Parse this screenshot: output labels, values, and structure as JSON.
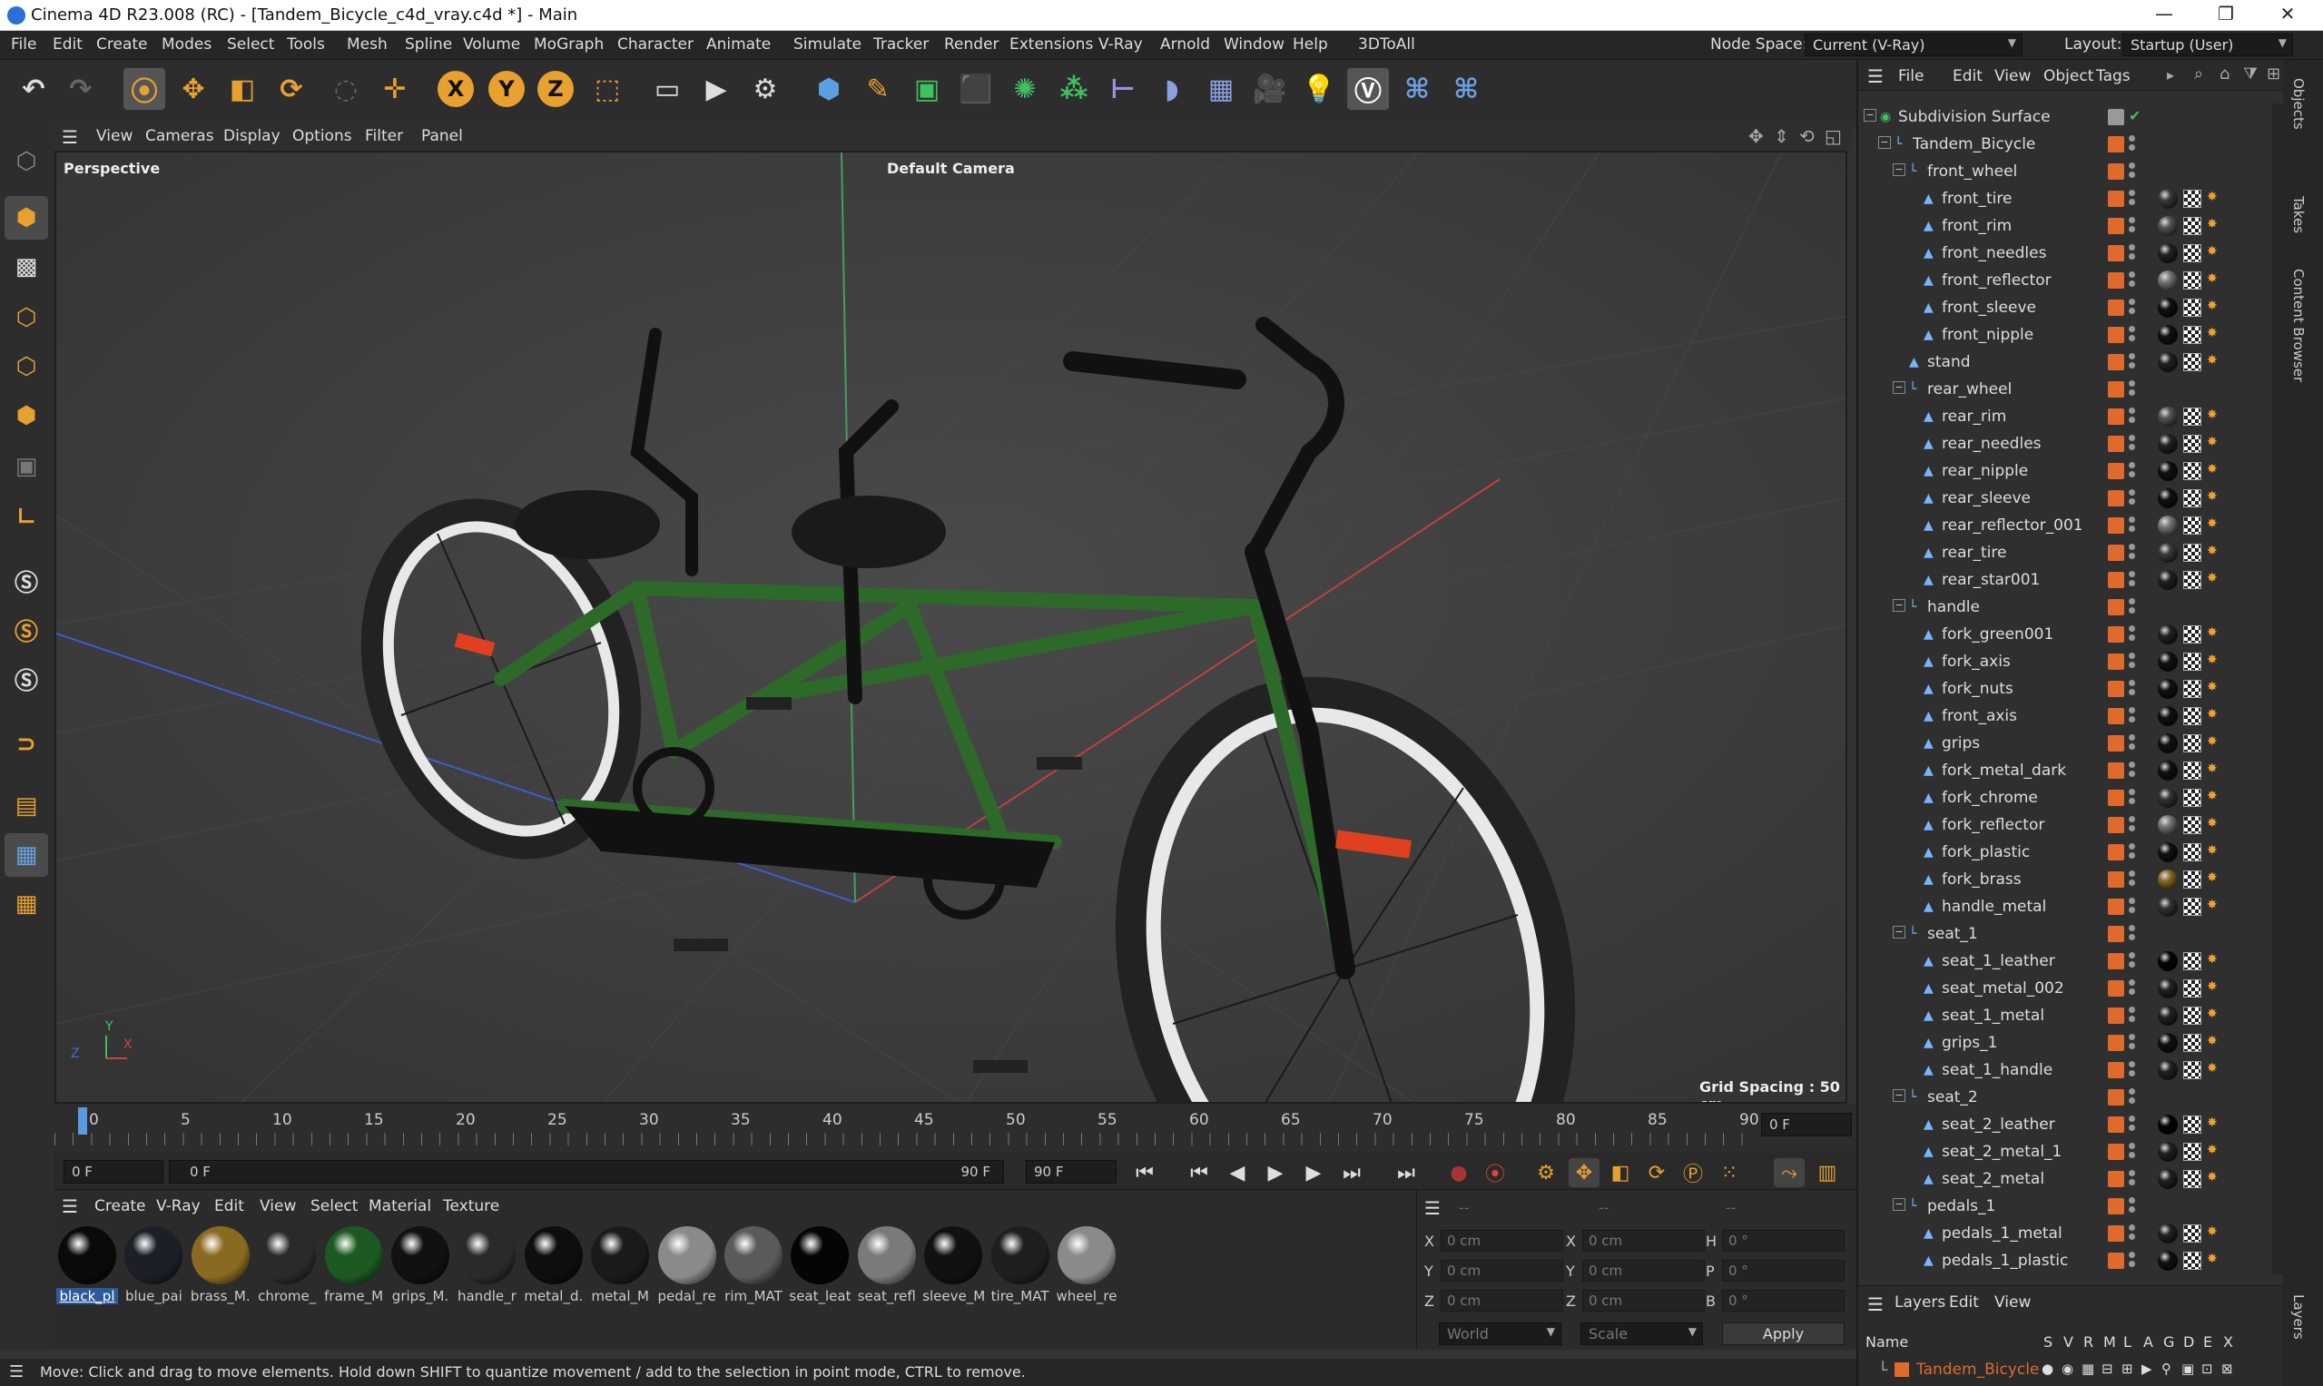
{
  "window": {
    "title": "Cinema 4D R23.008 (RC) - [Tandem_Bicycle_c4d_vray.c4d *] - Main",
    "minimize": "—",
    "maximize": "❐",
    "close": "✕"
  },
  "menubar": {
    "items": [
      "File",
      "Edit",
      "Create",
      "Modes",
      "Select",
      "Tools",
      "Mesh",
      "Spline",
      "Volume",
      "MoGraph",
      "Character",
      "Animate",
      "Simulate",
      "Tracker",
      "Render",
      "Extensions",
      "V-Ray",
      "Arnold",
      "Window",
      "Help",
      "3DToAll"
    ],
    "node_space_label": "Node Space:",
    "node_space_value": "Current (V-Ray)",
    "layout_label": "Layout:",
    "layout_value": "Startup (User)"
  },
  "toolbar": {
    "x_axis": "X",
    "y_axis": "Y",
    "z_axis": "Z"
  },
  "viewport": {
    "menu": [
      "View",
      "Cameras",
      "Display",
      "Options",
      "Filter",
      "Panel"
    ],
    "projection": "Perspective",
    "camera": "Default Camera",
    "grid_spacing": "Grid Spacing : 50 cm",
    "axis_x": "X",
    "axis_y": "Y",
    "axis_z": "Z"
  },
  "timeline": {
    "ticks": [
      "0",
      "5",
      "10",
      "15",
      "20",
      "25",
      "30",
      "35",
      "40",
      "45",
      "50",
      "55",
      "60",
      "65",
      "70",
      "75",
      "80",
      "85",
      "90"
    ],
    "current_frame": "0 F",
    "start_field": "0 F",
    "range_start": "0 F",
    "range_end": "90 F",
    "end_field": "90 F"
  },
  "materials": {
    "menu": [
      "Create",
      "V-Ray",
      "Edit",
      "View",
      "Select",
      "Material",
      "Texture"
    ],
    "items": [
      {
        "label": "black_pl",
        "color": "#0a0a0a",
        "selected": true
      },
      {
        "label": "blue_pai",
        "color": "#1c1f28"
      },
      {
        "label": "brass_M.",
        "color": "#8a6a20"
      },
      {
        "label": "chrome_",
        "color": "#2a2a2a"
      },
      {
        "label": "frame_M",
        "color": "#1d5a22"
      },
      {
        "label": "grips_M.",
        "color": "#111111"
      },
      {
        "label": "handle_r",
        "color": "#2a2a2a"
      },
      {
        "label": "metal_d.",
        "color": "#0e0e0e"
      },
      {
        "label": "metal_M",
        "color": "#1a1a1a"
      },
      {
        "label": "pedal_re",
        "color": "#8a8a8a"
      },
      {
        "label": "rim_MAT",
        "color": "#5a5a5a"
      },
      {
        "label": "seat_leat",
        "color": "#050505"
      },
      {
        "label": "seat_refl",
        "color": "#7a7a7a"
      },
      {
        "label": "sleeve_M",
        "color": "#111111"
      },
      {
        "label": "tire_MAT",
        "color": "#1e1e1e"
      },
      {
        "label": "wheel_re",
        "color": "#8a8a8a"
      }
    ]
  },
  "coords": {
    "x_label": "X",
    "y_label": "Y",
    "z_label": "Z",
    "h_label": "H",
    "p_label": "P",
    "b_label": "B",
    "pos_x": "0 cm",
    "pos_y": "0 cm",
    "pos_z": "0 cm",
    "size_x": "0 cm",
    "size_y": "0 cm",
    "size_z": "0 cm",
    "rot_h": "0 °",
    "rot_p": "0 °",
    "rot_b": "0 °",
    "header_1": "--",
    "header_2": "--",
    "header_3": "--",
    "mode_1": "World",
    "mode_2": "Scale",
    "apply": "Apply"
  },
  "status": "Move: Click and drag to move elements. Hold down SHIFT to quantize movement / add to the selection in point mode, CTRL to remove.",
  "objects": {
    "menu": [
      "File",
      "Edit",
      "View",
      "Object",
      "Tags"
    ],
    "tree": [
      {
        "name": "Subdivision Surface",
        "depth": 0,
        "group": true,
        "icon": "subdivision-icon"
      },
      {
        "name": "Tandem_Bicycle",
        "depth": 1,
        "group": true
      },
      {
        "name": "front_wheel",
        "depth": 2,
        "group": true
      },
      {
        "name": "front_tire",
        "depth": 3,
        "mat": "#3a3a3a"
      },
      {
        "name": "front_rim",
        "depth": 3,
        "mat": "#555"
      },
      {
        "name": "front_needles",
        "depth": 3,
        "mat": "#222"
      },
      {
        "name": "front_reflector",
        "depth": 3,
        "mat": "#777"
      },
      {
        "name": "front_sleeve",
        "depth": 3,
        "mat": "#111"
      },
      {
        "name": "front_nipple",
        "depth": 3,
        "mat": "#111"
      },
      {
        "name": "stand",
        "depth": 2,
        "mat": "#222"
      },
      {
        "name": "rear_wheel",
        "depth": 2,
        "group": true
      },
      {
        "name": "rear_rim",
        "depth": 3,
        "mat": "#555"
      },
      {
        "name": "rear_needles",
        "depth": 3,
        "mat": "#222"
      },
      {
        "name": "rear_nipple",
        "depth": 3,
        "mat": "#111"
      },
      {
        "name": "rear_sleeve",
        "depth": 3,
        "mat": "#111"
      },
      {
        "name": "rear_reflector_001",
        "depth": 3,
        "mat": "#777"
      },
      {
        "name": "rear_tire",
        "depth": 3,
        "mat": "#3a3a3a"
      },
      {
        "name": "rear_star001",
        "depth": 3,
        "mat": "#222"
      },
      {
        "name": "handle",
        "depth": 2,
        "group": true
      },
      {
        "name": "fork_green001",
        "depth": 3,
        "mat": "#222"
      },
      {
        "name": "fork_axis",
        "depth": 3,
        "mat": "#111"
      },
      {
        "name": "fork_nuts",
        "depth": 3,
        "mat": "#111"
      },
      {
        "name": "front_axis",
        "depth": 3,
        "mat": "#111"
      },
      {
        "name": "grips",
        "depth": 3,
        "mat": "#111"
      },
      {
        "name": "fork_metal_dark",
        "depth": 3,
        "mat": "#111"
      },
      {
        "name": "fork_chrome",
        "depth": 3,
        "mat": "#333"
      },
      {
        "name": "fork_reflector",
        "depth": 3,
        "mat": "#777"
      },
      {
        "name": "fork_plastic",
        "depth": 3,
        "mat": "#111"
      },
      {
        "name": "fork_brass",
        "depth": 3,
        "mat": "#8a6a20"
      },
      {
        "name": "handle_metal",
        "depth": 3,
        "mat": "#333"
      },
      {
        "name": "seat_1",
        "depth": 2,
        "group": true
      },
      {
        "name": "seat_1_leather",
        "depth": 3,
        "mat": "#050505"
      },
      {
        "name": "seat_metal_002",
        "depth": 3,
        "mat": "#222"
      },
      {
        "name": "seat_1_metal",
        "depth": 3,
        "mat": "#222"
      },
      {
        "name": "grips_1",
        "depth": 3,
        "mat": "#111"
      },
      {
        "name": "seat_1_handle",
        "depth": 3,
        "mat": "#222"
      },
      {
        "name": "seat_2",
        "depth": 2,
        "group": true
      },
      {
        "name": "seat_2_leather",
        "depth": 3,
        "mat": "#050505"
      },
      {
        "name": "seat_2_metal_1",
        "depth": 3,
        "mat": "#222"
      },
      {
        "name": "seat_2_metal",
        "depth": 3,
        "mat": "#222"
      },
      {
        "name": "pedals_1",
        "depth": 2,
        "group": true
      },
      {
        "name": "pedals_1_metal",
        "depth": 3,
        "mat": "#222"
      },
      {
        "name": "pedals_1_plastic",
        "depth": 3,
        "mat": "#111"
      }
    ]
  },
  "layers": {
    "menu": [
      "Layers",
      "Edit",
      "View"
    ],
    "name_col": "Name",
    "flags": [
      "S",
      "V",
      "R",
      "M",
      "L",
      "A",
      "G",
      "D",
      "E",
      "X"
    ],
    "row": "Tandem_Bicycle"
  },
  "side_tabs": [
    "Objects",
    "Takes",
    "Content Browser",
    "Layers"
  ],
  "colors": {
    "accent": "#e06a2c",
    "frame_green": "#2d6a2a",
    "axis_x": "#d04040",
    "axis_y": "#40c060",
    "axis_z": "#4070e0"
  }
}
